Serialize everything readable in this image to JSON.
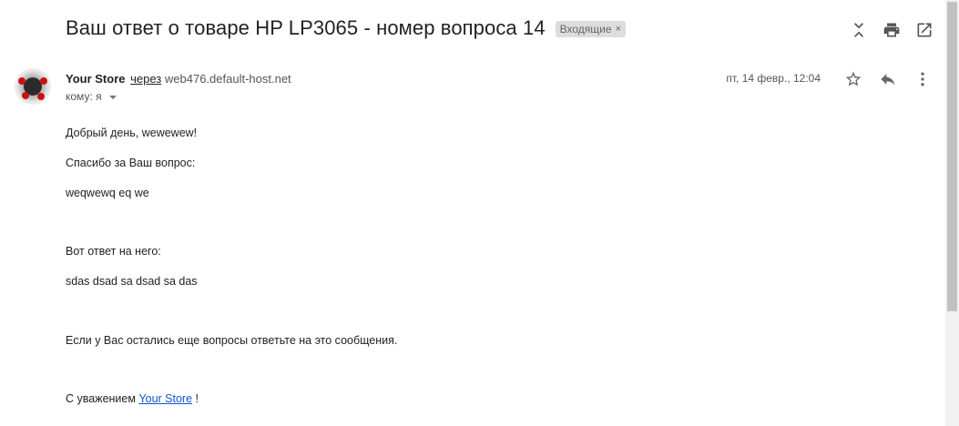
{
  "subject": "Ваш ответ о товаре HP LP3065 - номер вопроса 14",
  "label": {
    "text": "Входящие",
    "remove": "×"
  },
  "sender": {
    "name": "Your Store",
    "via": "через",
    "domain": "web476.default-host.net"
  },
  "to": {
    "label": "кому: я"
  },
  "date": "пт, 14 февр., 12:04",
  "body": {
    "greeting": "Добрый день, wewewew!",
    "thanks": "Спасибо за Ваш вопрос:",
    "question": "weqwewq eq we",
    "answer_intro": "Вот ответ на него:",
    "answer": "sdas dsad sa dsad sa das",
    "more": "Если у Вас остались еще вопросы ответьте на это сообщения.",
    "regards": "С уважением",
    "store_link": "Your Store",
    "regards_end": "!"
  },
  "icons": {
    "collapse": "collapse-all-icon",
    "print": "print-icon",
    "open": "open-new-window-icon",
    "star": "star-icon",
    "reply": "reply-icon",
    "more": "more-vert-icon"
  }
}
